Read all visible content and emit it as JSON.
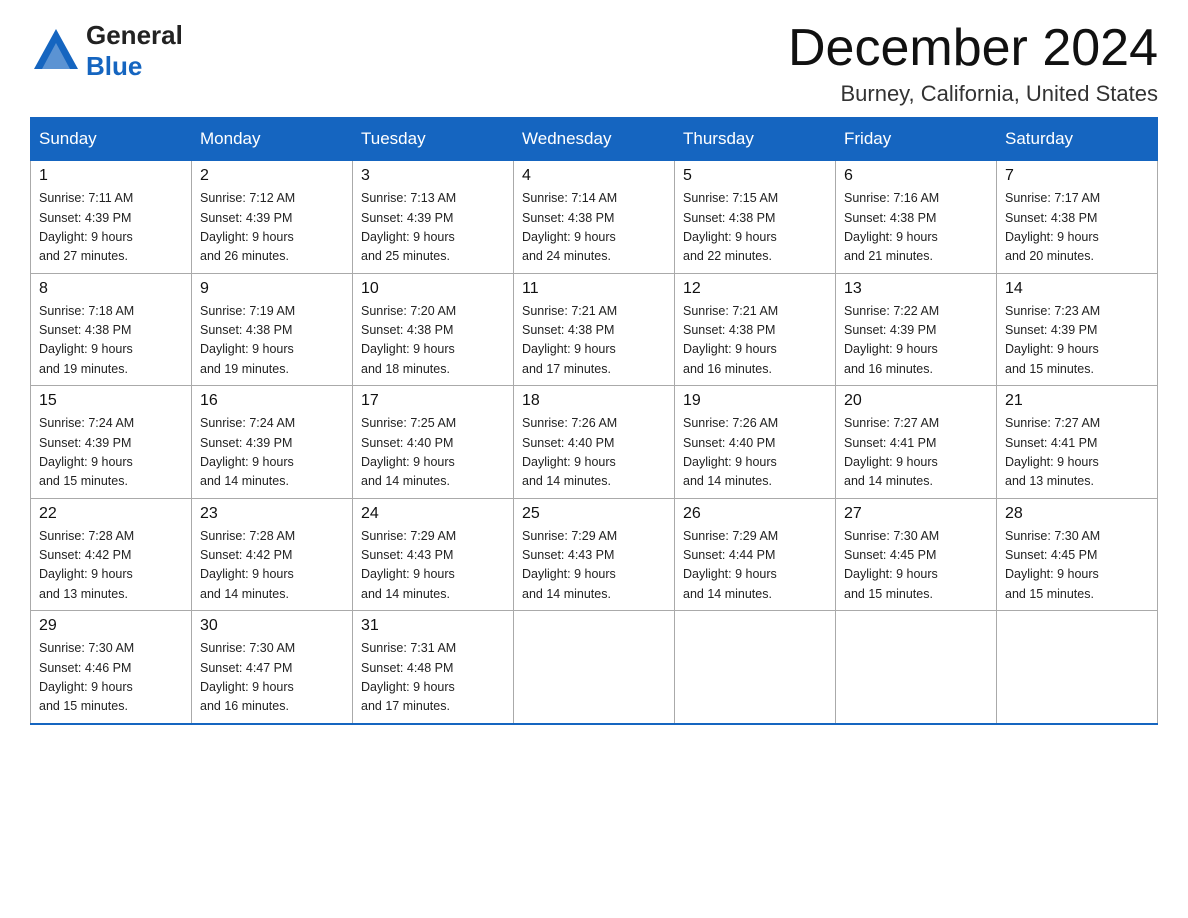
{
  "logo": {
    "general": "General",
    "blue": "Blue"
  },
  "title": {
    "month": "December 2024",
    "location": "Burney, California, United States"
  },
  "headers": [
    "Sunday",
    "Monday",
    "Tuesday",
    "Wednesday",
    "Thursday",
    "Friday",
    "Saturday"
  ],
  "weeks": [
    [
      {
        "day": "1",
        "sunrise": "7:11 AM",
        "sunset": "4:39 PM",
        "daylight": "9 hours and 27 minutes."
      },
      {
        "day": "2",
        "sunrise": "7:12 AM",
        "sunset": "4:39 PM",
        "daylight": "9 hours and 26 minutes."
      },
      {
        "day": "3",
        "sunrise": "7:13 AM",
        "sunset": "4:39 PM",
        "daylight": "9 hours and 25 minutes."
      },
      {
        "day": "4",
        "sunrise": "7:14 AM",
        "sunset": "4:38 PM",
        "daylight": "9 hours and 24 minutes."
      },
      {
        "day": "5",
        "sunrise": "7:15 AM",
        "sunset": "4:38 PM",
        "daylight": "9 hours and 22 minutes."
      },
      {
        "day": "6",
        "sunrise": "7:16 AM",
        "sunset": "4:38 PM",
        "daylight": "9 hours and 21 minutes."
      },
      {
        "day": "7",
        "sunrise": "7:17 AM",
        "sunset": "4:38 PM",
        "daylight": "9 hours and 20 minutes."
      }
    ],
    [
      {
        "day": "8",
        "sunrise": "7:18 AM",
        "sunset": "4:38 PM",
        "daylight": "9 hours and 19 minutes."
      },
      {
        "day": "9",
        "sunrise": "7:19 AM",
        "sunset": "4:38 PM",
        "daylight": "9 hours and 19 minutes."
      },
      {
        "day": "10",
        "sunrise": "7:20 AM",
        "sunset": "4:38 PM",
        "daylight": "9 hours and 18 minutes."
      },
      {
        "day": "11",
        "sunrise": "7:21 AM",
        "sunset": "4:38 PM",
        "daylight": "9 hours and 17 minutes."
      },
      {
        "day": "12",
        "sunrise": "7:21 AM",
        "sunset": "4:38 PM",
        "daylight": "9 hours and 16 minutes."
      },
      {
        "day": "13",
        "sunrise": "7:22 AM",
        "sunset": "4:39 PM",
        "daylight": "9 hours and 16 minutes."
      },
      {
        "day": "14",
        "sunrise": "7:23 AM",
        "sunset": "4:39 PM",
        "daylight": "9 hours and 15 minutes."
      }
    ],
    [
      {
        "day": "15",
        "sunrise": "7:24 AM",
        "sunset": "4:39 PM",
        "daylight": "9 hours and 15 minutes."
      },
      {
        "day": "16",
        "sunrise": "7:24 AM",
        "sunset": "4:39 PM",
        "daylight": "9 hours and 14 minutes."
      },
      {
        "day": "17",
        "sunrise": "7:25 AM",
        "sunset": "4:40 PM",
        "daylight": "9 hours and 14 minutes."
      },
      {
        "day": "18",
        "sunrise": "7:26 AM",
        "sunset": "4:40 PM",
        "daylight": "9 hours and 14 minutes."
      },
      {
        "day": "19",
        "sunrise": "7:26 AM",
        "sunset": "4:40 PM",
        "daylight": "9 hours and 14 minutes."
      },
      {
        "day": "20",
        "sunrise": "7:27 AM",
        "sunset": "4:41 PM",
        "daylight": "9 hours and 14 minutes."
      },
      {
        "day": "21",
        "sunrise": "7:27 AM",
        "sunset": "4:41 PM",
        "daylight": "9 hours and 13 minutes."
      }
    ],
    [
      {
        "day": "22",
        "sunrise": "7:28 AM",
        "sunset": "4:42 PM",
        "daylight": "9 hours and 13 minutes."
      },
      {
        "day": "23",
        "sunrise": "7:28 AM",
        "sunset": "4:42 PM",
        "daylight": "9 hours and 14 minutes."
      },
      {
        "day": "24",
        "sunrise": "7:29 AM",
        "sunset": "4:43 PM",
        "daylight": "9 hours and 14 minutes."
      },
      {
        "day": "25",
        "sunrise": "7:29 AM",
        "sunset": "4:43 PM",
        "daylight": "9 hours and 14 minutes."
      },
      {
        "day": "26",
        "sunrise": "7:29 AM",
        "sunset": "4:44 PM",
        "daylight": "9 hours and 14 minutes."
      },
      {
        "day": "27",
        "sunrise": "7:30 AM",
        "sunset": "4:45 PM",
        "daylight": "9 hours and 15 minutes."
      },
      {
        "day": "28",
        "sunrise": "7:30 AM",
        "sunset": "4:45 PM",
        "daylight": "9 hours and 15 minutes."
      }
    ],
    [
      {
        "day": "29",
        "sunrise": "7:30 AM",
        "sunset": "4:46 PM",
        "daylight": "9 hours and 15 minutes."
      },
      {
        "day": "30",
        "sunrise": "7:30 AM",
        "sunset": "4:47 PM",
        "daylight": "9 hours and 16 minutes."
      },
      {
        "day": "31",
        "sunrise": "7:31 AM",
        "sunset": "4:48 PM",
        "daylight": "9 hours and 17 minutes."
      },
      null,
      null,
      null,
      null
    ]
  ],
  "labels": {
    "sunrise": "Sunrise:",
    "sunset": "Sunset:",
    "daylight": "Daylight: 9 hours"
  }
}
